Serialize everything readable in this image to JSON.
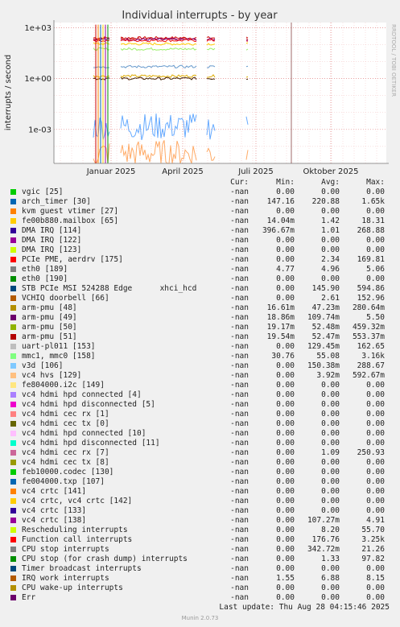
{
  "chart_data": {
    "type": "line",
    "title": "Individual interrupts - by year",
    "ylabel": "interrupts / second",
    "y_scale": "log",
    "ylim": [
      1e-05,
      2000
    ],
    "y_ticks": [
      {
        "value": 1000,
        "label": "1e+03"
      },
      {
        "value": 1,
        "label": "1e+00"
      },
      {
        "value": 0.001,
        "label": "1e-03"
      }
    ],
    "x_ticks": [
      "Januar 2025",
      "April 2025",
      "Juli 2025",
      "Oktober 2025"
    ],
    "grid": true,
    "watermark": "RRDTOOL / TOBI OETIKER",
    "visible_series": [
      {
        "name": "PCIe PME, aerdrv [175]",
        "color": "#cc0000",
        "level": 250
      },
      {
        "name": "arch_timer [30]",
        "color": "#cc3333",
        "level": 220
      },
      {
        "name": "arm-pmu [51]",
        "color": "#800080",
        "level": 200
      },
      {
        "name": "Function call interrupts",
        "color": "#ee1111",
        "level": 176
      },
      {
        "name": "arm-pmu [49]",
        "color": "#ffcc00",
        "level": 110
      },
      {
        "name": "mmc1, mmc0 [158]",
        "color": "#99ee66",
        "level": 55
      },
      {
        "name": "fe00b880.mailbox [65]",
        "color": "#ddaa00",
        "level": 1.4
      },
      {
        "name": "DMA IRQ [114]",
        "color": "#442200",
        "level": 1.0
      },
      {
        "name": "eth0 [189]",
        "color": "#6699cc",
        "level": 5
      },
      {
        "name": "v3d [106]",
        "color": "#66aaff",
        "level": 0.0015
      },
      {
        "name": "vc4 hvs [129]",
        "color": "#ffaa66",
        "level": 4e-05
      }
    ]
  },
  "legend": {
    "headers": {
      "cur": "Cur:",
      "min": "Min:",
      "avg": "Avg:",
      "max": "Max:"
    },
    "rows": [
      {
        "color": "#00cc00",
        "name": "vgic [25]",
        "cur": "-nan",
        "min": "0.00",
        "avg": "0.00",
        "max": "0.00"
      },
      {
        "color": "#0066b3",
        "name": "arch_timer [30]",
        "cur": "-nan",
        "min": "147.16",
        "avg": "220.88",
        "max": "1.65k"
      },
      {
        "color": "#ff8000",
        "name": "kvm guest vtimer [27]",
        "cur": "-nan",
        "min": "0.00",
        "avg": "0.00",
        "max": "0.00"
      },
      {
        "color": "#ffcc00",
        "name": "fe00b880.mailbox [65]",
        "cur": "-nan",
        "min": "14.04m",
        "avg": "1.42",
        "max": "18.31"
      },
      {
        "color": "#330099",
        "name": "DMA IRQ [114]",
        "cur": "-nan",
        "min": "396.67m",
        "avg": "1.01",
        "max": "268.88"
      },
      {
        "color": "#990099",
        "name": "DMA IRQ [122]",
        "cur": "-nan",
        "min": "0.00",
        "avg": "0.00",
        "max": "0.00"
      },
      {
        "color": "#ccff00",
        "name": "DMA IRQ [123]",
        "cur": "-nan",
        "min": "0.00",
        "avg": "0.00",
        "max": "0.00"
      },
      {
        "color": "#ff0000",
        "name": "PCIe PME, aerdrv [175]",
        "cur": "-nan",
        "min": "0.00",
        "avg": "2.34",
        "max": "169.81"
      },
      {
        "color": "#808080",
        "name": "eth0 [189]",
        "cur": "-nan",
        "min": "4.77",
        "avg": "4.96",
        "max": "5.06"
      },
      {
        "color": "#008f00",
        "name": "eth0 [190]",
        "cur": "-nan",
        "min": "0.00",
        "avg": "0.00",
        "max": "0.00"
      },
      {
        "color": "#00487d",
        "name": "STB PCIe MSI 524288 Edge      xhci_hcd",
        "cur": "-nan",
        "min": "0.00",
        "avg": "145.90",
        "max": "594.86"
      },
      {
        "color": "#b35a00",
        "name": "VCHIQ doorbell [66]",
        "cur": "-nan",
        "min": "0.00",
        "avg": "2.61",
        "max": "152.96"
      },
      {
        "color": "#b38f00",
        "name": "arm-pmu [48]",
        "cur": "-nan",
        "min": "16.61m",
        "avg": "47.23m",
        "max": "280.64m"
      },
      {
        "color": "#6b006b",
        "name": "arm-pmu [49]",
        "cur": "-nan",
        "min": "18.86m",
        "avg": "109.74m",
        "max": "5.50"
      },
      {
        "color": "#8fb300",
        "name": "arm-pmu [50]",
        "cur": "-nan",
        "min": "19.17m",
        "avg": "52.48m",
        "max": "459.32m"
      },
      {
        "color": "#b30000",
        "name": "arm-pmu [51]",
        "cur": "-nan",
        "min": "19.54m",
        "avg": "52.47m",
        "max": "553.37m"
      },
      {
        "color": "#bebebe",
        "name": "uart-pl011 [153]",
        "cur": "-nan",
        "min": "0.00",
        "avg": "129.45m",
        "max": "162.65"
      },
      {
        "color": "#80ff80",
        "name": "mmc1, mmc0 [158]",
        "cur": "-nan",
        "min": "30.76",
        "avg": "55.08",
        "max": "3.16k"
      },
      {
        "color": "#80c9ff",
        "name": "v3d [106]",
        "cur": "-nan",
        "min": "0.00",
        "avg": "150.38m",
        "max": "288.67"
      },
      {
        "color": "#ffc080",
        "name": "vc4 hvs [129]",
        "cur": "-nan",
        "min": "0.00",
        "avg": "3.92m",
        "max": "592.67m"
      },
      {
        "color": "#ffe680",
        "name": "fe804000.i2c [149]",
        "cur": "-nan",
        "min": "0.00",
        "avg": "0.00",
        "max": "0.00"
      },
      {
        "color": "#aa80ff",
        "name": "vc4 hdmi hpd connected [4]",
        "cur": "-nan",
        "min": "0.00",
        "avg": "0.00",
        "max": "0.00"
      },
      {
        "color": "#ee00cc",
        "name": "vc4 hdmi hpd disconnected [5]",
        "cur": "-nan",
        "min": "0.00",
        "avg": "0.00",
        "max": "0.00"
      },
      {
        "color": "#ff8080",
        "name": "vc4 hdmi cec rx [1]",
        "cur": "-nan",
        "min": "0.00",
        "avg": "0.00",
        "max": "0.00"
      },
      {
        "color": "#666600",
        "name": "vc4 hdmi cec tx [0]",
        "cur": "-nan",
        "min": "0.00",
        "avg": "0.00",
        "max": "0.00"
      },
      {
        "color": "#ffbfff",
        "name": "vc4 hdmi hpd connected [10]",
        "cur": "-nan",
        "min": "0.00",
        "avg": "0.00",
        "max": "0.00"
      },
      {
        "color": "#00ffcc",
        "name": "vc4 hdmi hpd disconnected [11]",
        "cur": "-nan",
        "min": "0.00",
        "avg": "0.00",
        "max": "0.00"
      },
      {
        "color": "#cc6699",
        "name": "vc4 hdmi cec rx [7]",
        "cur": "-nan",
        "min": "0.00",
        "avg": "1.09",
        "max": "250.93"
      },
      {
        "color": "#999900",
        "name": "vc4 hdmi cec tx [8]",
        "cur": "-nan",
        "min": "0.00",
        "avg": "0.00",
        "max": "0.00"
      },
      {
        "color": "#00cc00",
        "name": "feb10000.codec [130]",
        "cur": "-nan",
        "min": "0.00",
        "avg": "0.00",
        "max": "0.00"
      },
      {
        "color": "#0066b3",
        "name": "fe004000.txp [107]",
        "cur": "-nan",
        "min": "0.00",
        "avg": "0.00",
        "max": "0.00"
      },
      {
        "color": "#ff8000",
        "name": "vc4 crtc [141]",
        "cur": "-nan",
        "min": "0.00",
        "avg": "0.00",
        "max": "0.00"
      },
      {
        "color": "#ffcc00",
        "name": "vc4 crtc, vc4 crtc [142]",
        "cur": "-nan",
        "min": "0.00",
        "avg": "0.00",
        "max": "0.00"
      },
      {
        "color": "#330099",
        "name": "vc4 crtc [133]",
        "cur": "-nan",
        "min": "0.00",
        "avg": "0.00",
        "max": "0.00"
      },
      {
        "color": "#990099",
        "name": "vc4 crtc [138]",
        "cur": "-nan",
        "min": "0.00",
        "avg": "107.27m",
        "max": "4.91"
      },
      {
        "color": "#ccff00",
        "name": "Rescheduling interrupts",
        "cur": "-nan",
        "min": "0.00",
        "avg": "8.20",
        "max": "55.70"
      },
      {
        "color": "#ff0000",
        "name": "Function call interrupts",
        "cur": "-nan",
        "min": "0.00",
        "avg": "176.76",
        "max": "3.25k"
      },
      {
        "color": "#808080",
        "name": "CPU stop interrupts",
        "cur": "-nan",
        "min": "0.00",
        "avg": "342.72m",
        "max": "21.26"
      },
      {
        "color": "#008f00",
        "name": "CPU stop (for crash dump) interrupts",
        "cur": "-nan",
        "min": "0.00",
        "avg": "1.33",
        "max": "97.82"
      },
      {
        "color": "#00487d",
        "name": "Timer broadcast interrupts",
        "cur": "-nan",
        "min": "0.00",
        "avg": "0.00",
        "max": "0.00"
      },
      {
        "color": "#b35a00",
        "name": "IRQ work interrupts",
        "cur": "-nan",
        "min": "1.55",
        "avg": "6.88",
        "max": "8.15"
      },
      {
        "color": "#b38f00",
        "name": "CPU wake-up interrupts",
        "cur": "-nan",
        "min": "0.00",
        "avg": "0.00",
        "max": "0.00"
      },
      {
        "color": "#6b006b",
        "name": "Err",
        "cur": "-nan",
        "min": "0.00",
        "avg": "0.00",
        "max": "0.00"
      }
    ]
  },
  "footer": {
    "last_update": "Last update: Thu Aug 28 04:15:46 2025",
    "munin": "Munin 2.0.73"
  }
}
